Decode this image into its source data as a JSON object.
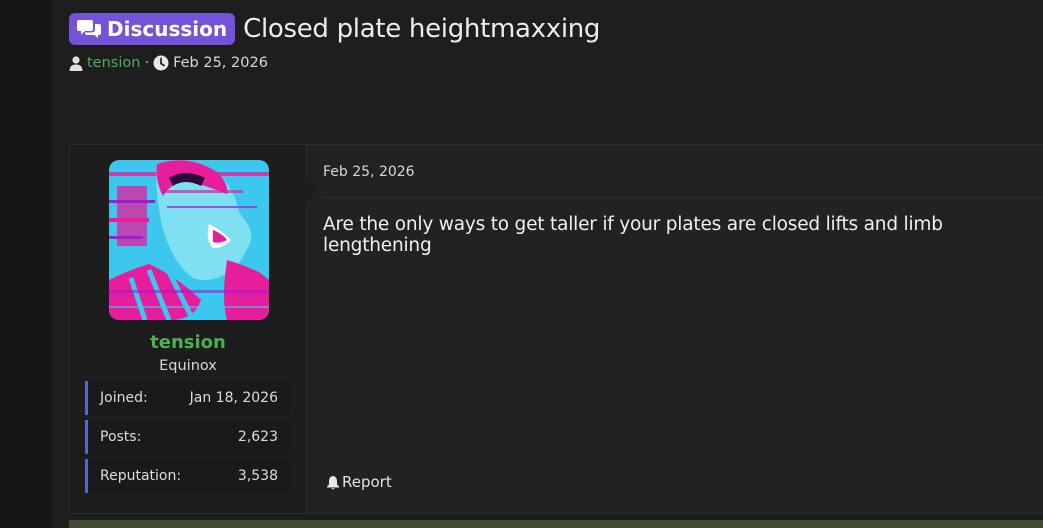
{
  "thread": {
    "prefix": "Discussion",
    "title": "Closed plate heightmaxxing",
    "author": "tension",
    "separator": "·",
    "date": "Feb 25, 2026"
  },
  "post": {
    "date": "Feb 25, 2026",
    "body": "Are the only ways to get taller if your plates are closed lifts and limb lengthening",
    "report_label": "Report"
  },
  "user": {
    "name": "tension",
    "title": "Equinox",
    "stats": [
      {
        "label": "Joined:",
        "value": "Jan 18, 2026"
      },
      {
        "label": "Posts:",
        "value": "2,623"
      },
      {
        "label": "Reputation:",
        "value": "3,538"
      }
    ]
  },
  "colors": {
    "prefix_bg": "#7553d8",
    "username": "#4caf50",
    "stat_accent": "#5a67c8",
    "avatar_cyan": "#3cc8ee",
    "avatar_magenta": "#e61e9b"
  },
  "icons": {
    "prefix": "comments-icon",
    "author": "user-icon",
    "date": "clock-icon",
    "report": "bell-icon"
  }
}
